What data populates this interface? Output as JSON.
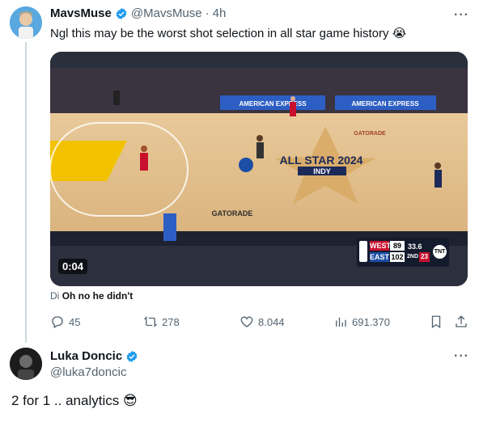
{
  "tweet": {
    "author_name": "MavsMuse",
    "author_handle": "@MavsMuse",
    "separator": "·",
    "time": "4h",
    "text": "Ngl this may be the worst shot selection in all star game history",
    "emoji": "😭",
    "video": {
      "timecode": "0:04",
      "scoreboard": {
        "team1": "WEST",
        "score1": "89",
        "team2": "EAST",
        "score2": "102",
        "clock": "33.6",
        "quarter": "2ND",
        "shot_clock": "23",
        "network": "TNT"
      },
      "court_text": {
        "logo_main": "ALL STAR 2024",
        "logo_sub": "INDY",
        "sponsor1": "AMERICAN EXPRESS",
        "sponsor2": "AMERICAN EXPRESS",
        "floor_ad": "GATORADE",
        "floor_ad2": "GATORADE"
      },
      "caption_prefix": "Di",
      "caption": "Oh no he didn't"
    },
    "stats": {
      "replies": "45",
      "retweets": "278",
      "likes": "8.044",
      "views": "691.370"
    }
  },
  "reply": {
    "author_name": "Luka Doncic",
    "author_handle": "@luka7doncic",
    "text": "2 for 1 .. analytics",
    "emoji": "😎"
  },
  "colors": {
    "accent": "#1d9bf0",
    "muted": "#536471",
    "line": "#cfd9de"
  }
}
